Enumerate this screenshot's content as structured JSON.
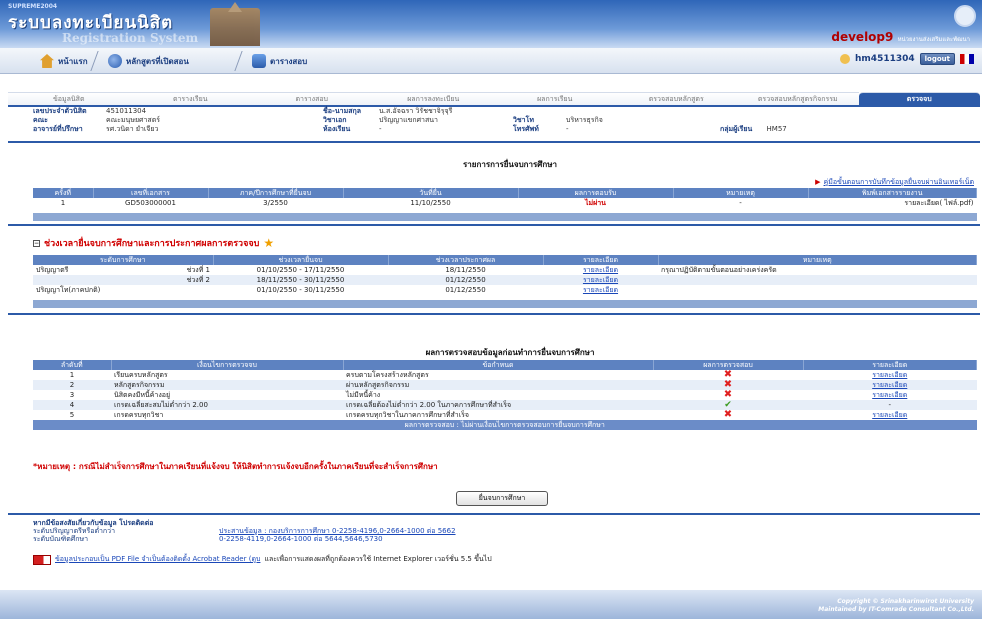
{
  "banner": {
    "university": "SUPREME2004",
    "system_th": "ระบบลงทะเบียนนิสิต",
    "system_en": "Registration System",
    "user_id": "develop9",
    "user_role": "หน่วยงานส่งเสริมและพัฒนา"
  },
  "nav": {
    "home": "หน้าแรก",
    "courses": "หลักสูตรที่เปิดสอน",
    "exam": "ตารางสอบ",
    "user": "hm4511304",
    "logout": "logout"
  },
  "tabs": [
    "ข้อมูลนิสิต",
    "ตารางเรียน",
    "ตารางสอบ",
    "ผลการลงทะเบียน",
    "ผลการเรียน",
    "ตรวจสอบหลักสูตร",
    "ตรวจสอบหลักสูตรกิจกรรม",
    "ตรวจจบ"
  ],
  "student": {
    "id_label": "เลขประจำตัวนิสิต",
    "id": "451011304",
    "faculty_label": "คณะ",
    "faculty": "คณะมนุษยศาสตร์",
    "advisor_label": "อาจารย์ที่ปรึกษา",
    "advisor": "รศ.วนิดา ยำเจียว",
    "name_label": "ชื่อ-นามสกุล",
    "name": "น.ส.อัจฉรา วิรัชชาจิรุจุรี",
    "major_label": "วิชาเอก",
    "major": "ปริญญาแขกศาสนา",
    "room_label": "ห้องเรียน",
    "room": "-",
    "minor_label": "วิชาโท",
    "minor": "บริหารธุรกิจ",
    "phone_label": "โทรศัพท์",
    "phone": "-",
    "group_label": "กลุ่มผู้เรียน",
    "group": "HM57"
  },
  "submission": {
    "title": "รายการการยื่นจบการศึกษา",
    "manual_link": "คู่มือขั้นตอนการบันทึกข้อมูลยื่นจบผ่านอินเทอร์เน็ต",
    "headers": [
      "ครั้งที่",
      "เลขที่เอกสาร",
      "ภาค/ปีการศึกษาที่ยื่นจบ",
      "วันที่ยื่น",
      "ผลการตอบรับ",
      "หมายเหตุ",
      "พิมพ์เอกสารรายงาน"
    ],
    "rows": [
      {
        "no": "1",
        "doc": "GD503000001",
        "term": "3/2550",
        "date": "11/10/2550",
        "result": "ไม่ผ่าน",
        "remark": "-",
        "print": "รายละเอียด( ไฟล์.pdf)"
      }
    ]
  },
  "period": {
    "title": "ช่วงเวลายื่นจบการศึกษาและการประกาศผลการตรวจจบ",
    "headers": [
      "ระดับการศึกษา",
      "ช่วงเวลายื่นจบ",
      "ช่วงเวลาประกาศผล",
      "รายละเอียด",
      "หมายเหตุ"
    ],
    "rows": [
      {
        "level": "ปริญญาตรี",
        "round": "ช่วงที่ 1",
        "submit": "01/10/2550 - 17/11/2550",
        "announce": "18/11/2550",
        "detail": "รายละเอียด",
        "note": "กรุณาปฏิบัติตามขั้นตอนอย่างเคร่งครัด"
      },
      {
        "level": "",
        "round": "ช่วงที่ 2",
        "submit": "18/11/2550 - 30/11/2550",
        "announce": "01/12/2550",
        "detail": "รายละเอียด",
        "note": ""
      },
      {
        "level": "ปริญญาโท(ภาคปกติ)",
        "round": "",
        "submit": "01/10/2550 - 30/11/2550",
        "announce": "01/12/2550",
        "detail": "รายละเอียด",
        "note": ""
      }
    ]
  },
  "check": {
    "title": "ผลการตรวจสอบข้อมูลก่อนทำการยื่นจบการศึกษา",
    "headers": [
      "ลำดับที่",
      "เงื่อนไขการตรวจจบ",
      "ข้อกำหนด",
      "ผลการตรวจสอบ",
      "รายละเอียด"
    ],
    "rows": [
      {
        "no": "1",
        "cond": "เรียนครบหลักสูตร",
        "rule": "ครบตามโครงสร้างหลักสูตร",
        "pass": false,
        "detail": "รายละเอียด"
      },
      {
        "no": "2",
        "cond": "หลักสูตรกิจกรรม",
        "rule": "ผ่านหลักสูตรกิจกรรม",
        "pass": false,
        "detail": "รายละเอียด"
      },
      {
        "no": "3",
        "cond": "นิสิตคงมีหนี้ค้างอยู่",
        "rule": "ไม่มีหนี้ค้าง",
        "pass": false,
        "detail": "รายละเอียด"
      },
      {
        "no": "4",
        "cond": "เกรดเฉลี่ยสะสมไม่ต่ำกว่า 2.00",
        "rule": "เกรดเฉลี่ยต้องไม่ต่ำกว่า 2.00 ในภาคการศึกษาที่สำเร็จ",
        "pass": true,
        "detail": "-"
      },
      {
        "no": "5",
        "cond": "เกรดครบทุกวิชา",
        "rule": "เกรดครบทุกวิชาในภาคการศึกษาที่สำเร็จ",
        "pass": false,
        "detail": "รายละเอียด"
      }
    ],
    "summary": "ผลการตรวจสอบ : ไม่ผ่านเงื่อนไขการตรวจสอบการยื่นจบการศึกษา"
  },
  "note": "*หมายเหตุ : กรณีไม่สำเร็จการศึกษาในภาคเรียนที่แจ้งจบ ให้นิสิตทำการแจ้งจบอีกครั้งในภาคเรียนที่จะสำเร็จการศึกษา",
  "submit_button": "ยื่นจบการศึกษา",
  "contact": {
    "title": "หากมีข้อสงสัยเกี่ยวกับข้อมูล โปรดติดต่อ",
    "bachelor_label": "ระดับปริญญาตรีหรือต่ำกว่า",
    "bachelor": "ประสานข้อมูล : กองบริการการศึกษา 0-2258-4196,0-2664-1000 ต่อ 5662",
    "grad_label": "ระดับบัณฑิตศึกษา",
    "grad": "0-2258-4119,0-2664-1000 ต่อ 5644,5646,5730"
  },
  "pdf_note": "ข้อมูลประกอบเป็น PDF File จำเป็นต้องติดตั้ง Acrobat Reader (ดูบ",
  "pdf_note2": "และเพื่อการแสดงผลที่ถูกต้องควรใช้ Internet Explorer เวอร์ชั่น 5.5 ขึ้นไป",
  "footer": {
    "copyright": "Copyright © Srinakharinwirot University",
    "maintained": "Maintained by IT-Comrade Consultant Co.,Ltd."
  }
}
